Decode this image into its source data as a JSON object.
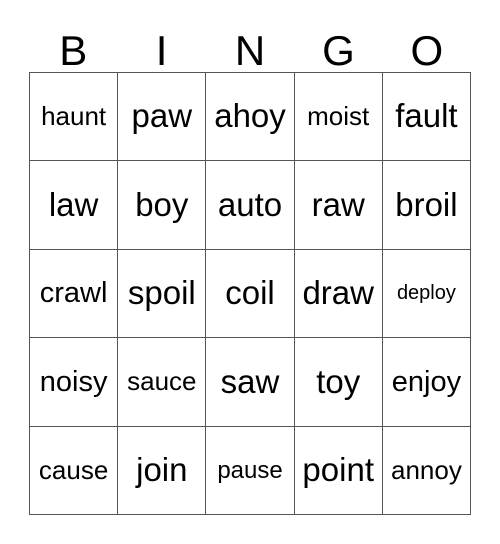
{
  "card": {
    "title": "Bingo Card",
    "header_letters": [
      "B",
      "I",
      "N",
      "G",
      "O"
    ],
    "colors": {
      "background": "#ffffff",
      "text": "#000000",
      "grid_line": "#555555"
    },
    "grid": {
      "columns": 5,
      "rows": 5,
      "rows_data": [
        {
          "cells": [
            {
              "word": "haunt",
              "size": "fs-m"
            },
            {
              "word": "paw",
              "size": "fs-xl"
            },
            {
              "word": "ahoy",
              "size": "fs-xl"
            },
            {
              "word": "moist",
              "size": "fs-m"
            },
            {
              "word": "fault",
              "size": "fs-xl"
            }
          ]
        },
        {
          "cells": [
            {
              "word": "law",
              "size": "fs-xl"
            },
            {
              "word": "boy",
              "size": "fs-xl"
            },
            {
              "word": "auto",
              "size": "fs-xl"
            },
            {
              "word": "raw",
              "size": "fs-xl"
            },
            {
              "word": "broil",
              "size": "fs-xl"
            }
          ]
        },
        {
          "cells": [
            {
              "word": "crawl",
              "size": "fs-l"
            },
            {
              "word": "spoil",
              "size": "fs-xl"
            },
            {
              "word": "coil",
              "size": "fs-xl"
            },
            {
              "word": "draw",
              "size": "fs-xl"
            },
            {
              "word": "deploy",
              "size": "fs-xs"
            }
          ]
        },
        {
          "cells": [
            {
              "word": "noisy",
              "size": "fs-l"
            },
            {
              "word": "sauce",
              "size": "fs-m"
            },
            {
              "word": "saw",
              "size": "fs-xl"
            },
            {
              "word": "toy",
              "size": "fs-xl"
            },
            {
              "word": "enjoy",
              "size": "fs-l"
            }
          ]
        },
        {
          "cells": [
            {
              "word": "cause",
              "size": "fs-m"
            },
            {
              "word": "join",
              "size": "fs-xl"
            },
            {
              "word": "pause",
              "size": "fs-s"
            },
            {
              "word": "point",
              "size": "fs-xl"
            },
            {
              "word": "annoy",
              "size": "fs-m"
            }
          ]
        }
      ]
    }
  }
}
